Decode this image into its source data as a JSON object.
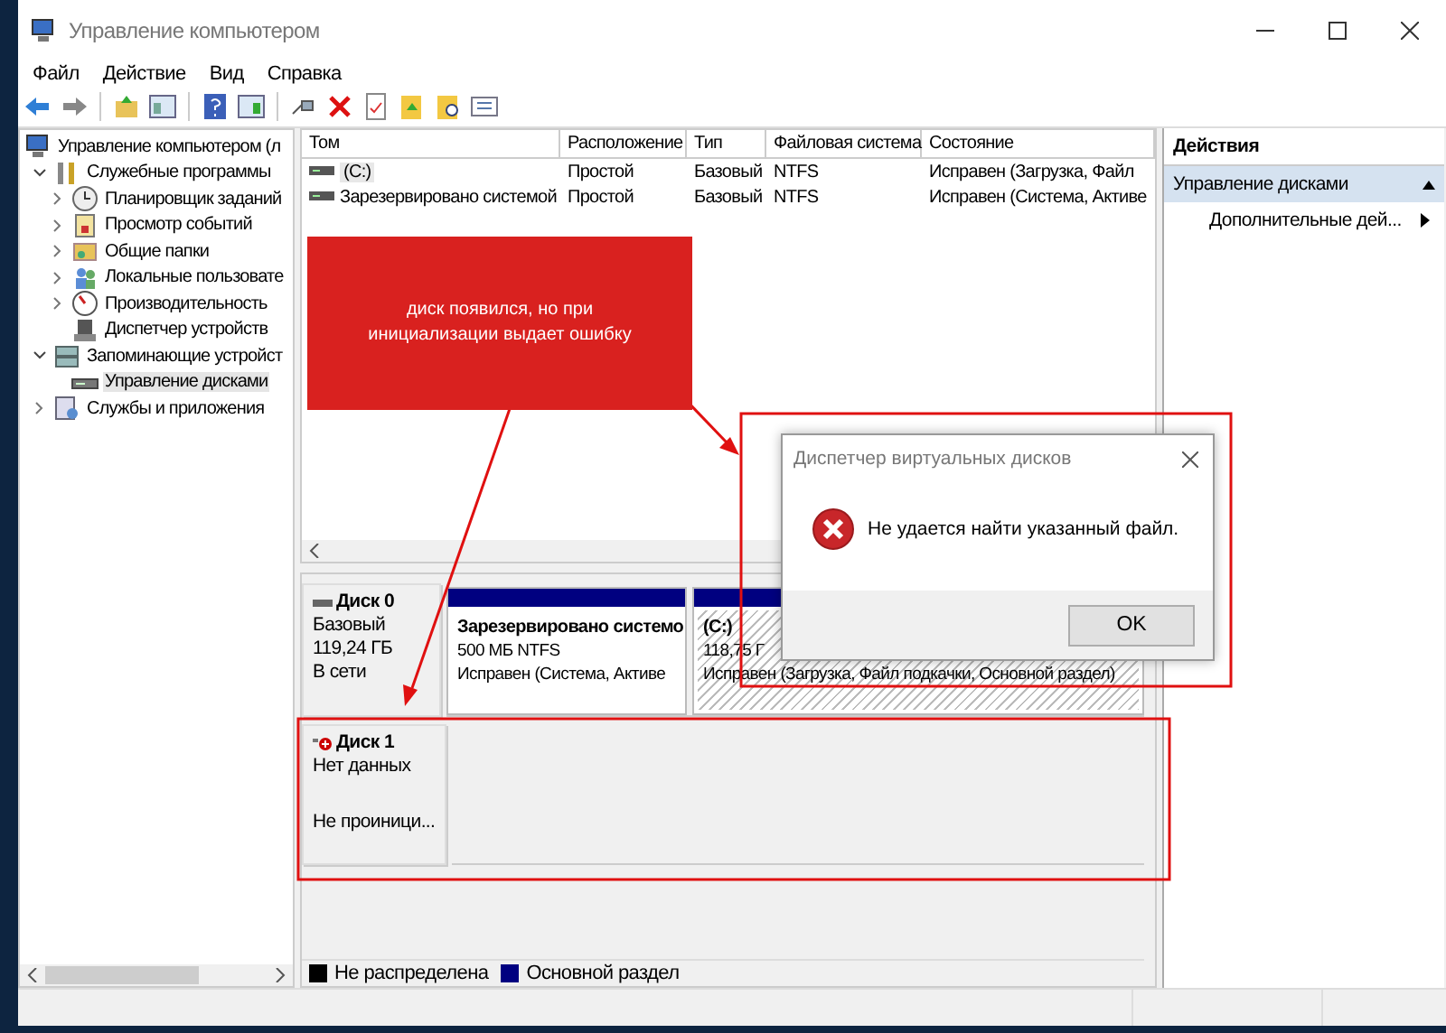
{
  "window": {
    "title": "Управление компьютером"
  },
  "menu": [
    "Файл",
    "Действие",
    "Вид",
    "Справка"
  ],
  "tree": [
    {
      "label": "Управление компьютером (л",
      "selected": false,
      "children": [
        {
          "label": "Служебные программы",
          "selected": false,
          "expanded": true,
          "children": [
            {
              "label": "Планировщик заданий",
              "selected": false,
              "expanded": false
            },
            {
              "label": "Просмотр событий",
              "selected": false,
              "expanded": false
            },
            {
              "label": "Общие папки",
              "selected": false,
              "expanded": false
            },
            {
              "label": "Локальные пользовате",
              "selected": false,
              "expanded": false
            },
            {
              "label": "Производительность",
              "selected": false,
              "expanded": false
            },
            {
              "label": "Диспетчер устройств",
              "selected": false
            }
          ]
        },
        {
          "label": "Запоминающие устройст",
          "selected": false,
          "expanded": true,
          "children": [
            {
              "label": "Управление дисками",
              "selected": true
            }
          ]
        },
        {
          "label": "Службы и приложения",
          "selected": false,
          "expanded": false
        }
      ]
    }
  ],
  "volumes": {
    "columns": [
      "Том",
      "Расположение",
      "Тип",
      "Файловая система",
      "Состояние"
    ],
    "rows": [
      {
        "cells": [
          "(C:)",
          "Простой",
          "Базовый",
          "NTFS",
          "Исправен (Загрузка, Файл"
        ],
        "selected": true
      },
      {
        "cells": [
          "Зарезервировано системой",
          "Простой",
          "Базовый",
          "NTFS",
          "Исправен (Система, Активе"
        ],
        "selected": false
      }
    ]
  },
  "disks": [
    {
      "name": "Диск 0",
      "type": "Базовый",
      "size": "119,24 ГБ",
      "state": "В сети",
      "error": false,
      "partitions": [
        {
          "lines": [
            "Зарезервировано системо",
            "500 МБ NTFS",
            "Исправен (Система, Активе"
          ],
          "selected": false
        },
        {
          "lines": [
            "(C:)",
            "118,75 Г",
            "Исправен (Загрузка, Файл подкачки, Основной раздел)"
          ],
          "selected": true
        }
      ]
    },
    {
      "name": "Диск 1",
      "type": "Нет данных",
      "state": "Не проиници...",
      "error": true
    }
  ],
  "legend": [
    {
      "label": "Не распределена",
      "color": "#000000"
    },
    {
      "label": "Основной раздел",
      "color": "#000080"
    }
  ],
  "actions": {
    "title": "Действия",
    "sections": [
      {
        "label": "Управление дисками",
        "expanded": true,
        "items": [
          "Дополнительные дей..."
        ]
      }
    ]
  },
  "dialog": {
    "title": "Диспетчер виртуальных дисков",
    "message": "Не удается найти указанный файл.",
    "button": "OK"
  },
  "annotation": {
    "text": "диск появился, но при инициализации выдает ошибку"
  }
}
